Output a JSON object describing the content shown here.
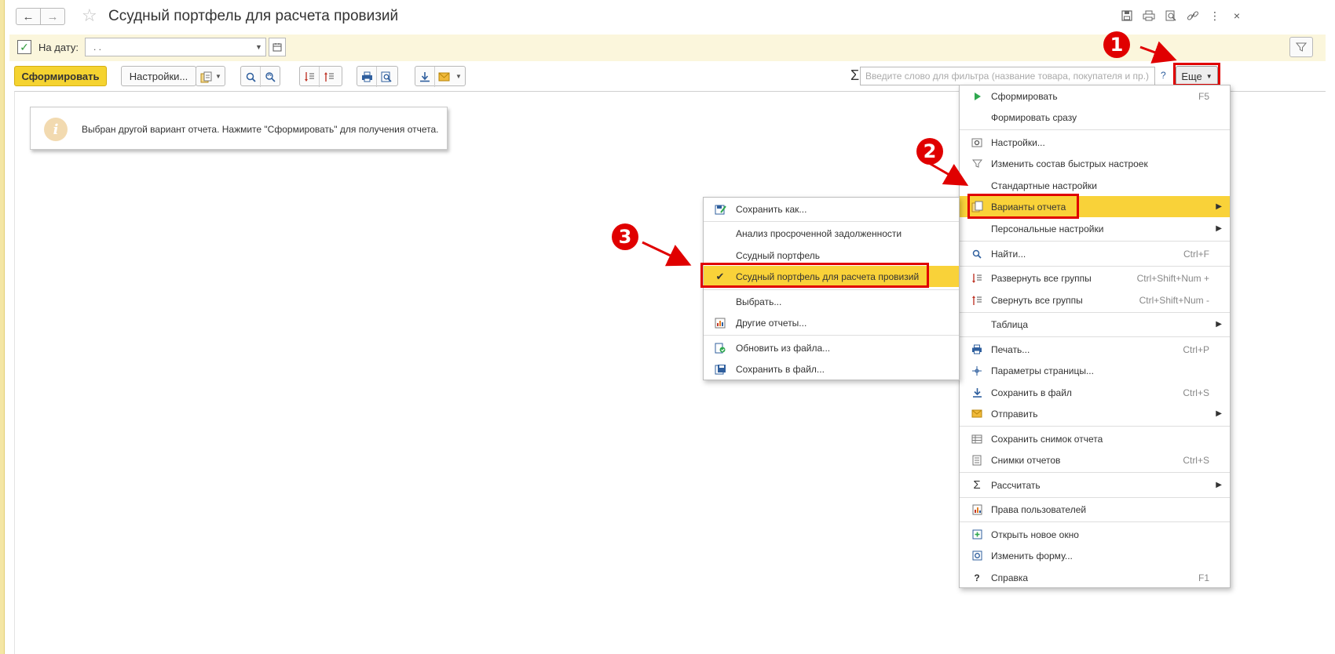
{
  "window": {
    "title": "Ссудный портфель для расчета провизий",
    "back_label": "🡐",
    "forward_label": "🡒"
  },
  "filter": {
    "date_label": "На дату:",
    "date_value": ".  .",
    "date_checked": true
  },
  "toolbar": {
    "generate_label": "Сформировать",
    "settings_label": "Настройки...",
    "search_placeholder": "Введите слово для фильтра (название товара, покупателя и пр.)",
    "help_label": "?",
    "more_label": "Еще"
  },
  "info": {
    "text": "Выбран другой вариант отчета. Нажмите \"Сформировать\" для получения отчета."
  },
  "main_menu": {
    "items": [
      {
        "label": "Сформировать",
        "shortcut": "F5",
        "icon": "play-icon"
      },
      {
        "label": "Формировать сразу",
        "shortcut": "",
        "icon": ""
      },
      {
        "label": "Настройки...",
        "shortcut": "",
        "icon": "settings-icon"
      },
      {
        "label": "Изменить состав быстрых настроек",
        "shortcut": "",
        "icon": "filter-icon"
      },
      {
        "label": "Стандартные настройки",
        "shortcut": "",
        "icon": ""
      },
      {
        "label": "Варианты отчета",
        "shortcut": "",
        "icon": "report-variants-icon",
        "submenu": true,
        "highlighted": true
      },
      {
        "label": "Персональные настройки",
        "shortcut": "",
        "icon": "",
        "submenu": true
      },
      {
        "label": "Найти...",
        "shortcut": "Ctrl+F",
        "icon": "search-icon"
      },
      {
        "label": "Развернуть все группы",
        "shortcut": "Ctrl+Shift+Num +",
        "icon": "expand-groups-icon"
      },
      {
        "label": "Свернуть все группы",
        "shortcut": "Ctrl+Shift+Num -",
        "icon": "collapse-groups-icon"
      },
      {
        "label": "Таблица",
        "shortcut": "",
        "icon": "",
        "submenu": true
      },
      {
        "label": "Печать...",
        "shortcut": "Ctrl+P",
        "icon": "print-icon"
      },
      {
        "label": "Параметры страницы...",
        "shortcut": "",
        "icon": "page-setup-icon"
      },
      {
        "label": "Сохранить в файл",
        "shortcut": "Ctrl+S",
        "icon": "download-icon"
      },
      {
        "label": "Отправить",
        "shortcut": "",
        "icon": "mail-icon",
        "submenu": true
      },
      {
        "label": "Сохранить снимок отчета",
        "shortcut": "",
        "icon": "snapshot-icon"
      },
      {
        "label": "Снимки отчетов",
        "shortcut": "Ctrl+S",
        "icon": "snapshots-list-icon"
      },
      {
        "label": "Рассчитать",
        "shortcut": "",
        "icon": "sigma-icon",
        "submenu": true
      },
      {
        "label": "Права пользователей",
        "shortcut": "",
        "icon": "user-rights-icon"
      },
      {
        "label": "Открыть новое окно",
        "shortcut": "",
        "icon": "new-window-icon"
      },
      {
        "label": "Изменить форму...",
        "shortcut": "",
        "icon": "edit-form-icon"
      },
      {
        "label": "Справка",
        "shortcut": "F1",
        "icon": "help-icon"
      }
    ]
  },
  "variants_menu": {
    "items": [
      {
        "label": "Сохранить как...",
        "icon": "save-as-icon"
      },
      {
        "label": "Анализ просроченной задолженности",
        "icon": ""
      },
      {
        "label": "Ссудный портфель",
        "icon": ""
      },
      {
        "label": "Ссудный портфель для расчета провизий",
        "icon": "check-icon",
        "checked": true,
        "highlighted": true
      },
      {
        "label": "Выбрать...",
        "icon": ""
      },
      {
        "label": "Другие отчеты...",
        "icon": "other-reports-icon"
      },
      {
        "label": "Обновить из файла...",
        "icon": "update-from-file-icon"
      },
      {
        "label": "Сохранить в файл...",
        "icon": "save-to-file-icon"
      }
    ]
  },
  "callouts": [
    "1",
    "2",
    "3"
  ],
  "colors": {
    "accent": "#f5d330",
    "highlight": "#f9d239",
    "annotation_red": "#e00000"
  }
}
